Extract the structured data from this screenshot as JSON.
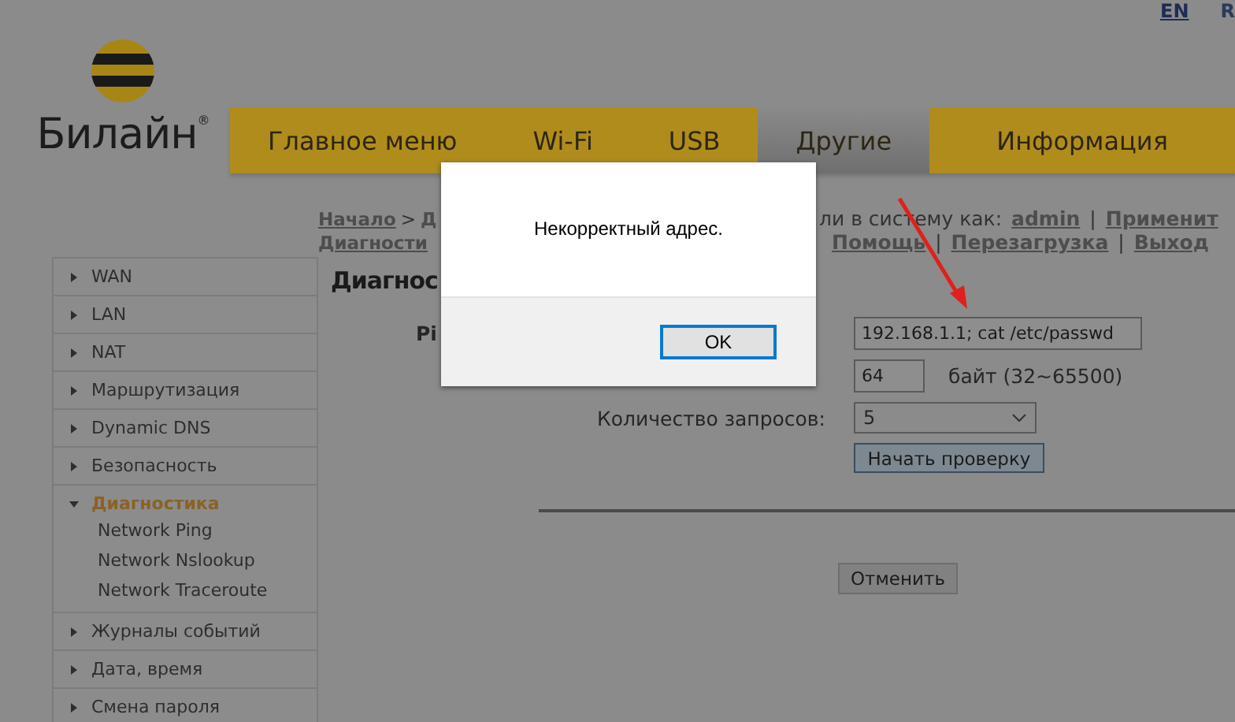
{
  "languages": [
    {
      "label": "EN",
      "selected": true
    },
    {
      "label": "R",
      "selected": false
    }
  ],
  "logo": {
    "text": "Билайн$^{®}$"
  },
  "nav": [
    {
      "label": "Главное меню",
      "selected": false
    },
    {
      "label": "Wi-Fi",
      "selected": false
    },
    {
      "label": "USB",
      "selected": false
    },
    {
      "label": "Другие",
      "selected": true
    },
    {
      "label": "Информация",
      "selected": false
    }
  ],
  "breadcrumb": {
    "line_1_left": [
      {
        "text": "Начало",
        "link": true
      },
      {
        "text": ">",
        "link": false
      },
      {
        "text": "Д",
        "link": true
      }
    ],
    "line_1_right": [
      {
        "text": "ли в систему как:",
        "link": false
      },
      {
        "text": "admin",
        "link": true
      },
      {
        "text": "|",
        "link": false
      },
      {
        "text": "Применит",
        "link": true
      }
    ],
    "line_2_left": [
      {
        "text": "Диагности",
        "link": true
      }
    ],
    "line_2_right": [
      {
        "text": "Помощь",
        "link": true
      },
      {
        "text": "|",
        "link": false
      },
      {
        "text": "Перезагрузка",
        "link": true
      },
      {
        "text": "|",
        "link": false
      },
      {
        "text": "Выход",
        "link": true
      }
    ]
  },
  "sidebar": [
    {
      "label": "WAN",
      "expanded": false,
      "selected": false
    },
    {
      "label": "LAN",
      "expanded": false,
      "selected": false
    },
    {
      "label": "NAT",
      "expanded": false,
      "selected": false
    },
    {
      "label": "Маршрутизация",
      "expanded": false,
      "selected": false
    },
    {
      "label": "Dynamic DNS",
      "expanded": false,
      "selected": false
    },
    {
      "label": "Безопасность",
      "expanded": false,
      "selected": false
    },
    {
      "label": "Диагностика",
      "expanded": true,
      "selected": true,
      "children": [
        {
          "label": "Network Ping"
        },
        {
          "label": "Network Nslookup"
        },
        {
          "label": "Network Traceroute"
        }
      ]
    },
    {
      "label": "Журналы событий",
      "expanded": false,
      "selected": false
    },
    {
      "label": "Дата, время",
      "expanded": false,
      "selected": false
    },
    {
      "label": "Смена пароля",
      "expanded": false,
      "selected": false
    }
  ],
  "content": {
    "heading": "Диагнос",
    "form": [
      {
        "kind": "text",
        "label": "Pi",
        "emphasis": true,
        "value": "192.168.1.1; cat /etc/passwd"
      },
      {
        "kind": "short",
        "value": "64",
        "suffix": "байт (32~65500)"
      },
      {
        "kind": "select",
        "label": "Количество запросов:",
        "emphasis": false,
        "value": "5"
      }
    ],
    "start_button": "Начать проверку",
    "cancel_button": "Отменить"
  },
  "dialog": {
    "message": "Некорректный адрес.",
    "ok_button": "OK"
  }
}
